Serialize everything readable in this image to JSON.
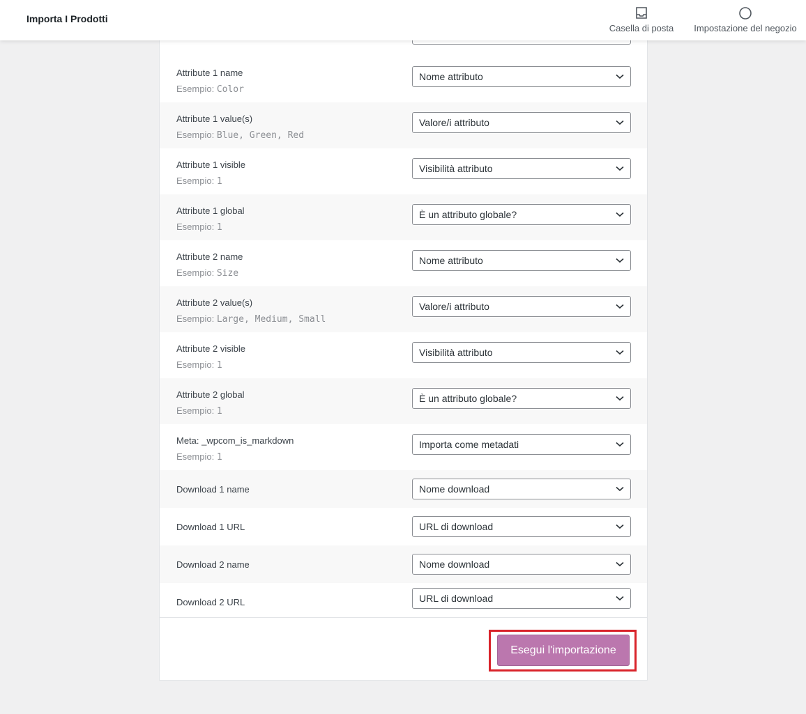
{
  "header": {
    "title": "Importa I Prodotti",
    "inbox_label": "Casella di posta",
    "store_settings_label": "Impostazione del negozio"
  },
  "example_prefix": "Esempio:",
  "rows": [
    {
      "label": "Attribute 1 name",
      "example": "Color",
      "select": "Nome attributo"
    },
    {
      "label": "Attribute 1 value(s)",
      "example": "Blue, Green, Red",
      "select": "Valore/i attributo"
    },
    {
      "label": "Attribute 1 visible",
      "example": "1",
      "select": "Visibilità attributo"
    },
    {
      "label": "Attribute 1 global",
      "example": "1",
      "select": "È un attributo globale?"
    },
    {
      "label": "Attribute 2 name",
      "example": "Size",
      "select": "Nome attributo"
    },
    {
      "label": "Attribute 2 value(s)",
      "example": "Large, Medium, Small",
      "select": "Valore/i attributo"
    },
    {
      "label": "Attribute 2 visible",
      "example": "1",
      "select": "Visibilità attributo"
    },
    {
      "label": "Attribute 2 global",
      "example": "1",
      "select": "È un attributo globale?"
    },
    {
      "label": "Meta: _wpcom_is_markdown",
      "example": "1",
      "select": "Importa come metadati"
    },
    {
      "label": "Download 1 name",
      "select": "Nome download"
    },
    {
      "label": "Download 1 URL",
      "select": "URL di download"
    },
    {
      "label": "Download 2 name",
      "select": "Nome download"
    },
    {
      "label": "Download 2 URL",
      "select": "URL di download"
    }
  ],
  "run_import_label": "Esegui l'importazione",
  "colors": {
    "button": "#bb77ae",
    "highlight": "#d9232a"
  }
}
